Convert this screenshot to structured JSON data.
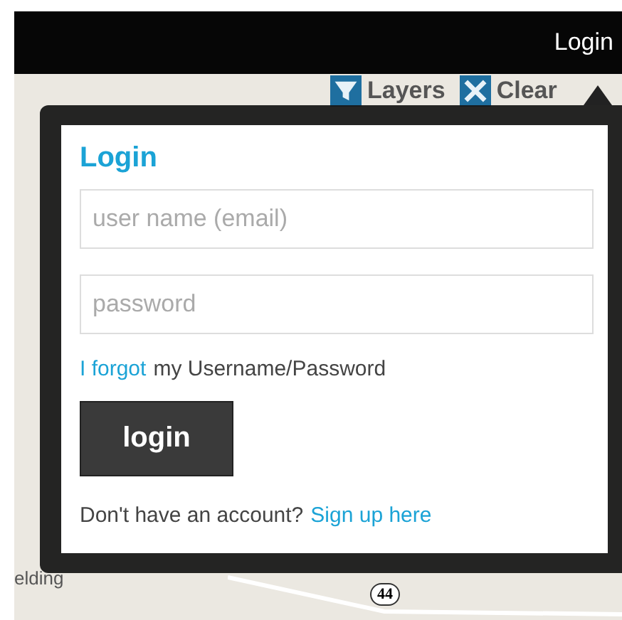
{
  "top_bar": {
    "login_link": "Login"
  },
  "map": {
    "toolbar": [
      {
        "label": "Layers",
        "kind": "layers"
      },
      {
        "label": "Clear",
        "kind": "clear"
      }
    ],
    "place_label": "elding",
    "road_shield": "44"
  },
  "login_popup": {
    "title": "Login",
    "fields": [
      {
        "placeholder": "user name (email)"
      },
      {
        "placeholder": "password"
      }
    ],
    "forgot": {
      "link": "I forgot",
      "text": "my Username/Password"
    },
    "submit_button": "login",
    "signup": {
      "text": "Don't have an account?",
      "link": "Sign up here"
    }
  }
}
